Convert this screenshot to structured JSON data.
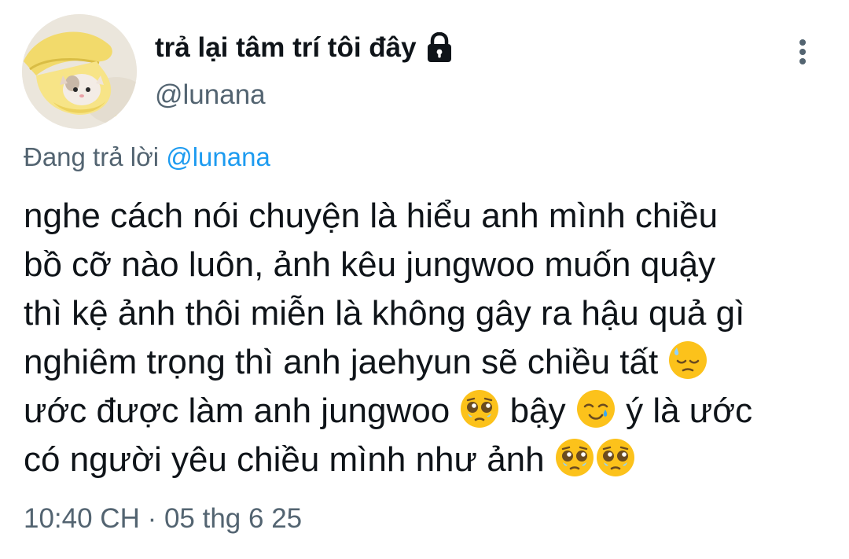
{
  "tweet": {
    "author": {
      "display_name": "trả lại tâm trí tôi đây",
      "handle": "@lunana",
      "protected_icon": "lock-icon",
      "avatar_icon": "cat-in-banana-avatar"
    },
    "more_icon": "vertical-ellipsis-icon",
    "reply": {
      "prefix": "Đang trả lời",
      "mention": "@lunana"
    },
    "text_lines": [
      {
        "text": "nghe cách nói chuyện là hiểu anh mình chiều"
      },
      {
        "text": "bồ cỡ nào luôn, ảnh kêu jungwoo muốn quậy"
      },
      {
        "text": "thì kệ ảnh thôi miễn là không gây ra hậu quả gì"
      },
      {
        "text": "nghiêm trọng thì anh jaehyun sẽ chiều tất",
        "emoji": "downcast-face-with-sweat"
      },
      {
        "part1": "ước được làm anh jungwoo",
        "emoji1": "pleading-face",
        "part2": "bậy",
        "emoji2": "smiling-face-with-tear",
        "part3": "ý là ước"
      },
      {
        "text": "có người yêu chiều mình như ảnh",
        "emoji": "pleading-face",
        "emoji2": "pleading-face"
      }
    ],
    "timestamp": "10:40 CH · 05 thg 6 25"
  },
  "colors": {
    "text": "#0f1419",
    "secondary": "#536471",
    "accent": "#1d9bf0",
    "background": "#ffffff"
  }
}
